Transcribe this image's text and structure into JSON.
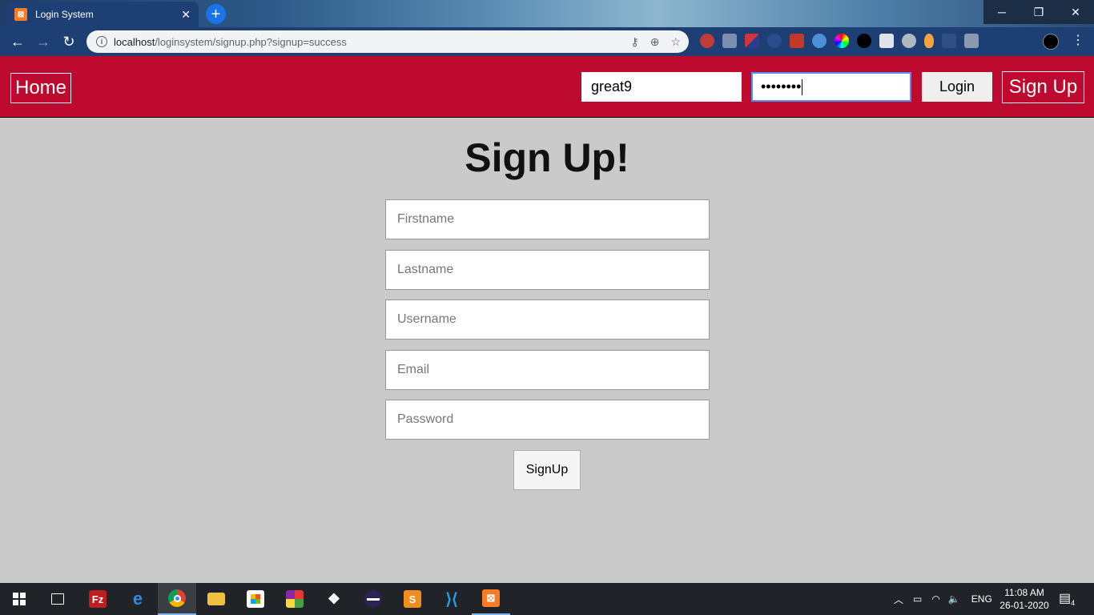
{
  "browser": {
    "tab_title": "Login System",
    "tab_favicon": "xampp-icon",
    "url_host": "localhost",
    "url_path": "/loginsystem/signup.php?signup=success"
  },
  "header": {
    "home_label": "Home",
    "username_value": "great9",
    "password_value": "••••••••",
    "login_label": "Login",
    "signup_label": "Sign Up",
    "accent_color": "#bf0a30"
  },
  "main": {
    "title": "Sign Up!",
    "fields": [
      {
        "placeholder": "Firstname"
      },
      {
        "placeholder": "Lastname"
      },
      {
        "placeholder": "Username"
      },
      {
        "placeholder": "Email"
      },
      {
        "placeholder": "Password"
      }
    ],
    "submit_label": "SignUp"
  },
  "taskbar": {
    "items": [
      "windows-start-icon",
      "task-view-icon",
      "filezilla-icon",
      "edge-icon",
      "chrome-icon",
      "file-explorer-icon",
      "store-icon",
      "colored-grid-icon",
      "dropbox-icon",
      "eclipse-icon",
      "sublime-icon",
      "vscode-icon",
      "xampp-icon"
    ],
    "language": "ENG",
    "time": "11:08 AM",
    "date": "26-01-2020",
    "notification_count": "4"
  }
}
